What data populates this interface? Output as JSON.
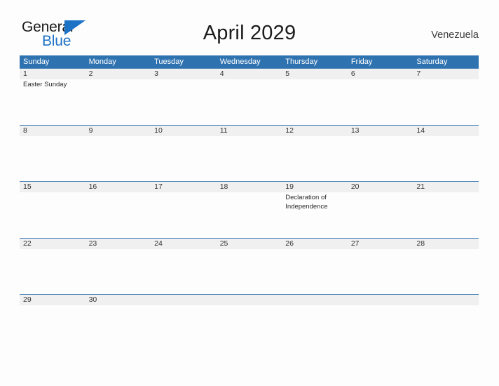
{
  "brand": {
    "name_part1": "General",
    "name_part2": "Blue",
    "flag_icon": "blue-triangle-flag-icon",
    "primary_color": "#1c72c4"
  },
  "header": {
    "title": "April 2029",
    "country": "Venezuela",
    "header_band_color": "#2e72b0",
    "date_band_color": "#f0f0f0",
    "row_line_color": "#4a82b8"
  },
  "calendar": {
    "month": "April",
    "year": "2029",
    "weekdays": [
      "Sunday",
      "Monday",
      "Tuesday",
      "Wednesday",
      "Thursday",
      "Friday",
      "Saturday"
    ],
    "weeks": [
      [
        {
          "date": "1",
          "event": "Easter Sunday"
        },
        {
          "date": "2",
          "event": ""
        },
        {
          "date": "3",
          "event": ""
        },
        {
          "date": "4",
          "event": ""
        },
        {
          "date": "5",
          "event": ""
        },
        {
          "date": "6",
          "event": ""
        },
        {
          "date": "7",
          "event": ""
        }
      ],
      [
        {
          "date": "8",
          "event": ""
        },
        {
          "date": "9",
          "event": ""
        },
        {
          "date": "10",
          "event": ""
        },
        {
          "date": "11",
          "event": ""
        },
        {
          "date": "12",
          "event": ""
        },
        {
          "date": "13",
          "event": ""
        },
        {
          "date": "14",
          "event": ""
        }
      ],
      [
        {
          "date": "15",
          "event": ""
        },
        {
          "date": "16",
          "event": ""
        },
        {
          "date": "17",
          "event": ""
        },
        {
          "date": "18",
          "event": ""
        },
        {
          "date": "19",
          "event": "Declaration of Independence"
        },
        {
          "date": "20",
          "event": ""
        },
        {
          "date": "21",
          "event": ""
        }
      ],
      [
        {
          "date": "22",
          "event": ""
        },
        {
          "date": "23",
          "event": ""
        },
        {
          "date": "24",
          "event": ""
        },
        {
          "date": "25",
          "event": ""
        },
        {
          "date": "26",
          "event": ""
        },
        {
          "date": "27",
          "event": ""
        },
        {
          "date": "28",
          "event": ""
        }
      ],
      [
        {
          "date": "29",
          "event": ""
        },
        {
          "date": "30",
          "event": ""
        },
        {
          "date": "",
          "event": ""
        },
        {
          "date": "",
          "event": ""
        },
        {
          "date": "",
          "event": ""
        },
        {
          "date": "",
          "event": ""
        },
        {
          "date": "",
          "event": ""
        }
      ]
    ]
  }
}
